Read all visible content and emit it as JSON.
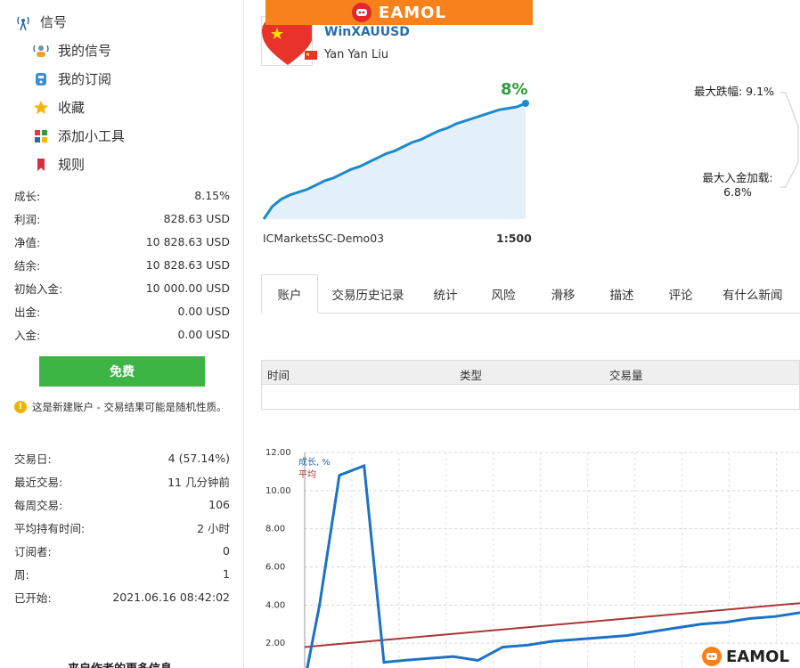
{
  "sidebar": {
    "header": "信号",
    "nav": [
      {
        "label": "我的信号",
        "icon": "signal-user-icon"
      },
      {
        "label": "我的订阅",
        "icon": "subscription-icon"
      },
      {
        "label": "收藏",
        "icon": "star-icon"
      },
      {
        "label": "添加小工具",
        "icon": "widget-icon"
      },
      {
        "label": "规则",
        "icon": "bookmark-icon"
      }
    ],
    "stats": [
      {
        "label": "成长:",
        "value": "8.15%"
      },
      {
        "label": "利润:",
        "value": "828.63 USD"
      },
      {
        "label": "净值:",
        "value": "10 828.63 USD"
      },
      {
        "label": "结余:",
        "value": "10 828.63 USD"
      },
      {
        "label": "初始入金:",
        "value": "10 000.00 USD"
      },
      {
        "label": "出金:",
        "value": "0.00 USD"
      },
      {
        "label": "入金:",
        "value": "0.00 USD"
      }
    ],
    "free_button": "免费",
    "notice": "这是新建账户 - 交易结果可能是随机性质。",
    "stats2": [
      {
        "label": "交易日:",
        "value": "4 (57.14%)"
      },
      {
        "label": "最近交易:",
        "value": "11 几分钟前"
      },
      {
        "label": "每周交易:",
        "value": "106"
      },
      {
        "label": "平均持有时间:",
        "value": "2 小时"
      },
      {
        "label": "订阅者:",
        "value": "0"
      },
      {
        "label": "周:",
        "value": "1"
      },
      {
        "label": "已开始:",
        "value": "2021.06.16 08:42:02"
      }
    ],
    "more_info": "来自作者的更多信息"
  },
  "header": {
    "logo_text": "EAMOL",
    "signal_name": "WinXAUUSD",
    "author": "Yan Yan Liu",
    "growth_label": "8%",
    "broker": "ICMarketsSC-Demo03",
    "leverage": "1:500",
    "max_drawdown": "最大跌幅: 9.1%",
    "max_deposit_load_label": "最大入金加载:",
    "max_deposit_load_value": "6.8%"
  },
  "colors": {
    "accent_blue": "#1c8ac8",
    "brand_orange": "#f7821b",
    "free_green": "#3cb545",
    "avg_red": "#a83838",
    "growth_green": "#2f9a3f"
  },
  "tabs": [
    {
      "label": "账户",
      "active": true
    },
    {
      "label": "交易历史记录",
      "active": false
    },
    {
      "label": "统计",
      "active": false
    },
    {
      "label": "风险",
      "active": false
    },
    {
      "label": "滑移",
      "active": false
    },
    {
      "label": "描述",
      "active": false
    },
    {
      "label": "评论",
      "active": false
    },
    {
      "label": "有什么新闻",
      "active": false
    }
  ],
  "table": {
    "columns": [
      "时间",
      "类型",
      "交易量"
    ]
  },
  "chart_data": [
    {
      "type": "area",
      "title": "",
      "x": [
        0,
        1,
        2,
        3,
        4,
        5,
        6,
        7,
        8,
        9,
        10,
        11,
        12,
        13,
        14,
        15,
        16,
        17,
        18,
        19,
        20,
        21,
        22,
        23,
        24,
        25,
        26,
        27,
        28,
        29,
        30
      ],
      "values": [
        0.0,
        0.9,
        1.4,
        1.7,
        1.9,
        2.1,
        2.4,
        2.7,
        2.9,
        3.2,
        3.5,
        3.7,
        4.0,
        4.3,
        4.6,
        4.8,
        5.1,
        5.4,
        5.6,
        5.9,
        6.2,
        6.4,
        6.7,
        6.9,
        7.1,
        7.3,
        7.5,
        7.7,
        7.8,
        7.9,
        8.15
      ],
      "ylim": [
        0,
        8.15
      ]
    },
    {
      "type": "line",
      "yticks": [
        "12.00",
        "10.00",
        "8.00",
        "6.00",
        "4.00",
        "2.00"
      ],
      "ylim": [
        0,
        12
      ],
      "xlim": [
        0,
        100
      ],
      "series": [
        {
          "name": "成长, %",
          "x": [
            0,
            3,
            7,
            12,
            16,
            20,
            25,
            30,
            35,
            40,
            45,
            50,
            55,
            60,
            65,
            70,
            75,
            80,
            85,
            90,
            95,
            100
          ],
          "values": [
            0,
            4.0,
            10.8,
            11.3,
            1.0,
            1.1,
            1.2,
            1.3,
            1.1,
            1.8,
            1.9,
            2.1,
            2.2,
            2.3,
            2.4,
            2.6,
            2.8,
            3.0,
            3.1,
            3.3,
            3.4,
            3.6
          ]
        },
        {
          "name": "平均",
          "x": [
            0,
            100
          ],
          "values": [
            1.8,
            4.1
          ]
        }
      ]
    }
  ]
}
